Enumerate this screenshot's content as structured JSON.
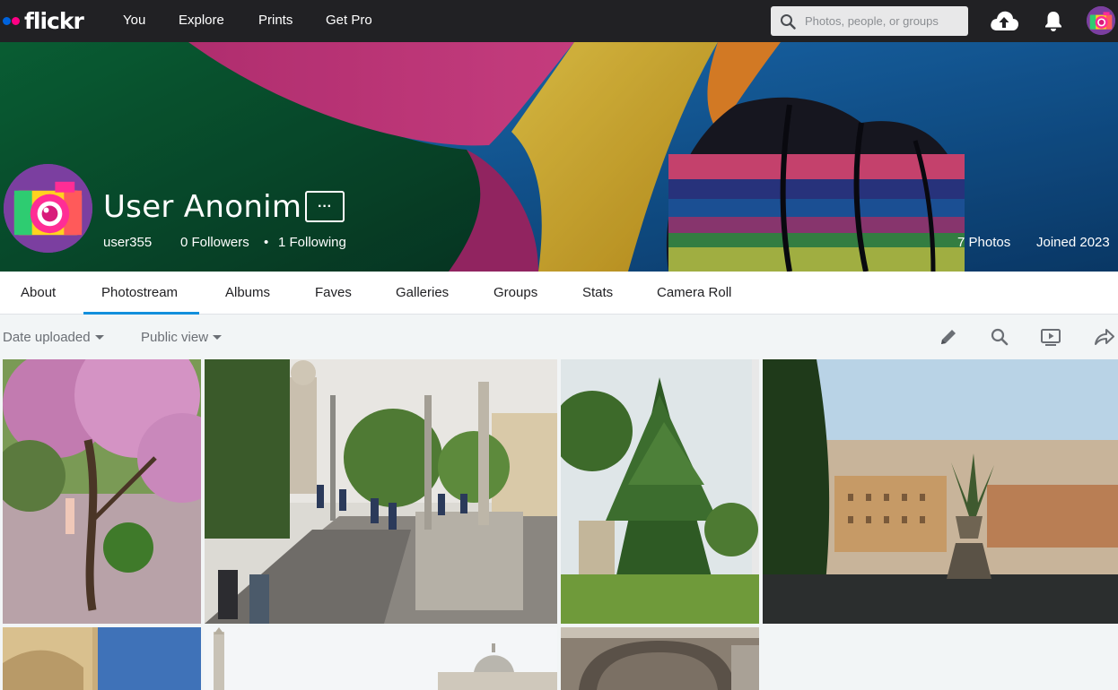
{
  "nav": {
    "logo_text": "flickr",
    "links": [
      "You",
      "Explore",
      "Prints",
      "Get Pro"
    ],
    "search_placeholder": "Photos, people, or groups"
  },
  "profile": {
    "name": "User Anonim",
    "more_label": "···",
    "username": "user355",
    "followers": "0 Followers",
    "separator": "•",
    "following": "1 Following",
    "photos": "7 Photos",
    "joined": "Joined 2023"
  },
  "tabs": [
    "About",
    "Photostream",
    "Albums",
    "Faves",
    "Galleries",
    "Groups",
    "Stats",
    "Camera Roll"
  ],
  "active_tab": "Photostream",
  "toolbar": {
    "sort_label": "Date uploaded",
    "view_label": "Public view"
  },
  "colors": {
    "accent": "#128fdc",
    "nav_bg": "#212124",
    "flickr_blue": "#0063dc",
    "flickr_pink": "#ff0084"
  },
  "icons": {
    "search": "magnifier-icon",
    "upload": "cloud-upload-icon",
    "notifications": "bell-icon",
    "edit": "pencil-icon",
    "search_stream": "magnifier-icon",
    "slideshow": "monitor-play-icon",
    "share": "share-arrow-icon"
  }
}
